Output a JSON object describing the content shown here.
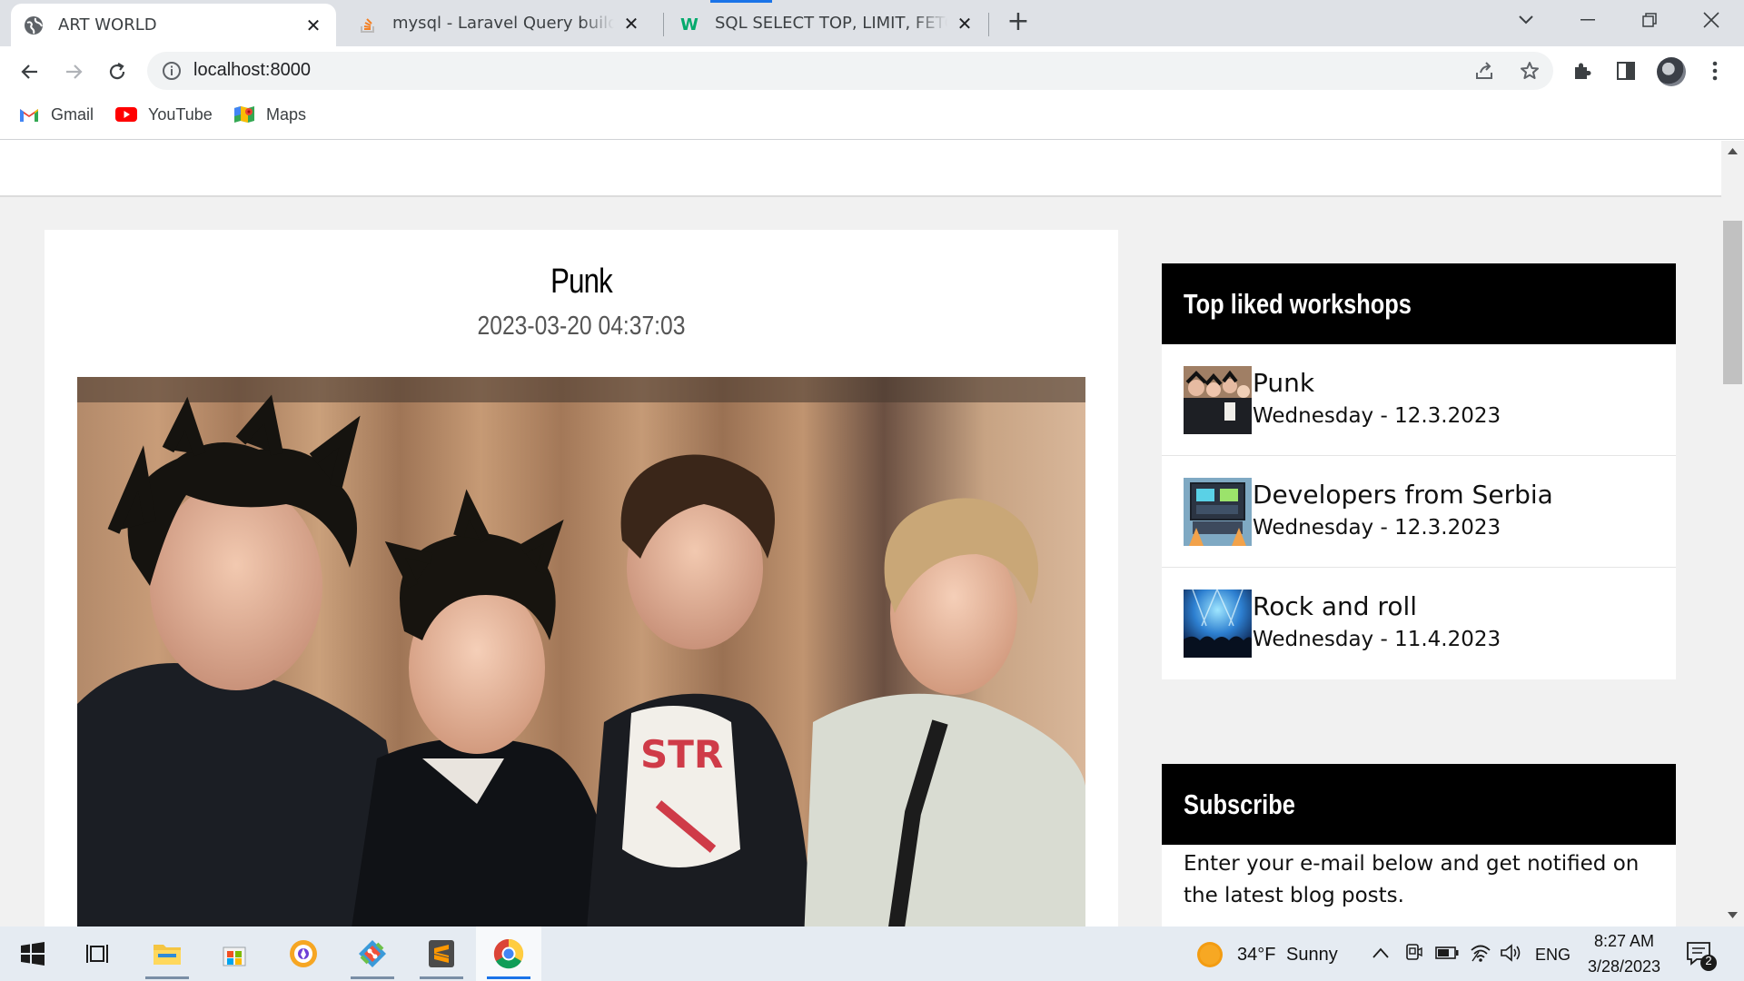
{
  "browser": {
    "tabs": [
      {
        "title": "ART WORLD",
        "active": true,
        "icon": "globe-icon"
      },
      {
        "title": "mysql - Laravel Query builder - so",
        "active": false,
        "icon": "stackoverflow-icon"
      },
      {
        "title": "SQL SELECT TOP, LIMIT, FETCH FI",
        "active": false,
        "icon": "w3schools-icon"
      }
    ],
    "url": "localhost:8000",
    "bookmarks": [
      {
        "label": "Gmail",
        "icon": "gmail-icon"
      },
      {
        "label": "YouTube",
        "icon": "youtube-icon"
      },
      {
        "label": "Maps",
        "icon": "maps-icon"
      }
    ]
  },
  "post": {
    "title": "Punk",
    "date": "2023-03-20 04:37:03"
  },
  "sidebar": {
    "top_liked": {
      "heading": "Top liked workshops",
      "items": [
        {
          "name": "Punk",
          "date": "Wednesday - 12.3.2023"
        },
        {
          "name": "Developers from Serbia",
          "date": "Wednesday - 12.3.2023"
        },
        {
          "name": "Rock and roll",
          "date": "Wednesday - 11.4.2023"
        }
      ]
    },
    "subscribe": {
      "heading": "Subscribe",
      "text": "Enter your e-mail below and get notified on the latest blog posts."
    }
  },
  "taskbar": {
    "weather": {
      "temp": "34°F",
      "condition": "Sunny"
    },
    "language": "ENG",
    "time": "8:27 AM",
    "date": "3/28/2023",
    "notifications": "2"
  },
  "colors": {
    "sidebar_header": "#000000",
    "page_background": "#f1f1f1",
    "tab_strip": "#dee1e6"
  }
}
